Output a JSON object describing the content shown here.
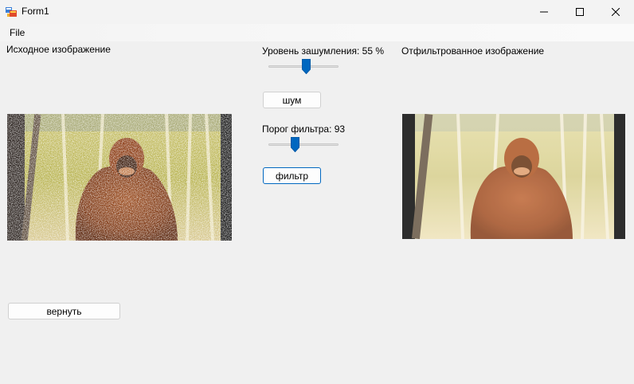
{
  "window": {
    "title": "Form1",
    "icon": "form-app-icon",
    "controls": [
      "minimize-icon",
      "maximize-icon",
      "close-icon"
    ]
  },
  "menu": {
    "items": [
      {
        "label": "File"
      }
    ]
  },
  "labels": {
    "source_image": "Исходное изображение",
    "noise_level": "Уровень зашумления: 55 %",
    "filter_threshold": "Порог фильтра: 93",
    "filtered_image": "Отфильтрованное изображение"
  },
  "buttons": {
    "noise": "шум",
    "filter": "фильтр",
    "restore": "вернуть"
  },
  "sliders": {
    "noise_level": {
      "value": 55,
      "min": 0,
      "max": 100
    },
    "filter_threshold": {
      "value": 93,
      "min": 0,
      "max": 255
    }
  },
  "images": {
    "source": {
      "content": "noisy photo of an orangutan",
      "icon": "orangutan-noisy-image"
    },
    "filtered": {
      "content": "filtered photo of an orangutan",
      "icon": "orangutan-filtered-image"
    }
  },
  "colors": {
    "accent": "#0067c0",
    "background": "#f0f0f0"
  }
}
